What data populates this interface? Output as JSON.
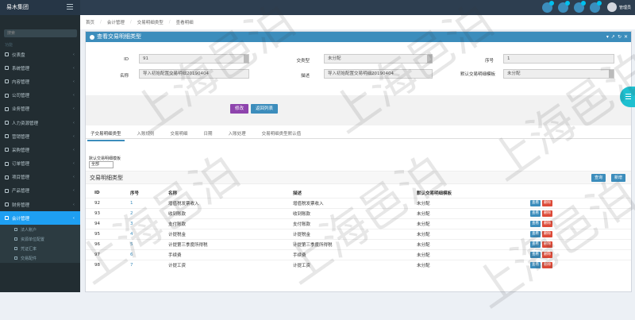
{
  "app": {
    "brand": "易木集团",
    "user_name": "管理员"
  },
  "sidebar": {
    "search_placeholder": "搜索",
    "section_label": "功能",
    "items": [
      {
        "label": "仪表盘"
      },
      {
        "label": "系统管理"
      },
      {
        "label": "内容管理"
      },
      {
        "label": "公司管理"
      },
      {
        "label": "业务管理"
      },
      {
        "label": "人力资源管理"
      },
      {
        "label": "营销管理"
      },
      {
        "label": "采购管理"
      },
      {
        "label": "订单管理"
      },
      {
        "label": "项目管理"
      },
      {
        "label": "产品管理"
      },
      {
        "label": "财务管理"
      },
      {
        "label": "会计管理"
      }
    ],
    "subitems": [
      {
        "label": "法人账户"
      },
      {
        "label": "资源单位配置"
      },
      {
        "label": "凭证汇率"
      },
      {
        "label": "交易配件"
      }
    ]
  },
  "breadcrumb": [
    "首页",
    "会计管理",
    "交易明细类型",
    "查看明细"
  ],
  "panel": {
    "title": "查看交易明细类型",
    "labels": {
      "id": "ID",
      "type": "交类型",
      "seq": "序号",
      "name": "名称",
      "desc": "描述",
      "default_template": "默认交易明细模板"
    },
    "values": {
      "id": "91",
      "type": "未分配",
      "seq": "1",
      "name": "导入初始配置交易明细20190404",
      "desc": "导入初始配置交易明细20190404",
      "default_template": "未分配"
    },
    "buttons": {
      "edit": "修改",
      "back": "返回列表"
    }
  },
  "tabs": [
    "子交易明细类型",
    "入账规则",
    "交易明细",
    "日期",
    "入账处理",
    "交易明细类型默认值"
  ],
  "filter": {
    "label": "默认交易明细模板",
    "value": "全部"
  },
  "subpanel": {
    "title": "交易明细类型",
    "search": "查询",
    "new": "新增"
  },
  "table": {
    "headers": [
      "ID",
      "序号",
      "名称",
      "描述",
      "默认交易明细模板"
    ],
    "op_view": "查看",
    "op_delete": "删除",
    "rows": [
      [
        "92",
        "1",
        "增值税发票收入",
        "增值税发票收入",
        "未分配"
      ],
      [
        "93",
        "2",
        "收到账款",
        "收到账款",
        "未分配"
      ],
      [
        "94",
        "3",
        "支付账款",
        "支付账款",
        "未分配"
      ],
      [
        "95",
        "4",
        "计提税金",
        "计提税金",
        "未分配"
      ],
      [
        "96",
        "5",
        "计提第三季度所得税",
        "计提第三季度所得税",
        "未分配"
      ],
      [
        "97",
        "6",
        "手续费",
        "手续费",
        "未分配"
      ],
      [
        "98",
        "7",
        "计提工资",
        "计提工资",
        "未分配"
      ]
    ]
  },
  "watermark": "上海邑泊"
}
